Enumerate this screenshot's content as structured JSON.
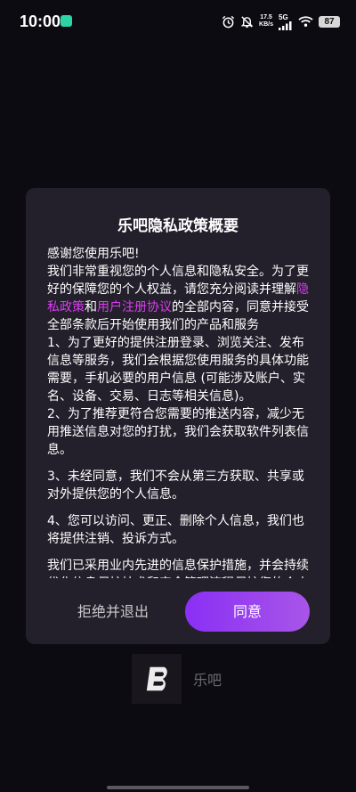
{
  "status_bar": {
    "time": "10:00",
    "net_speed_value": "17.5",
    "net_speed_unit": "KB/s",
    "network_type": "5G",
    "battery": "87",
    "icons": [
      "app-notification-icon",
      "alarm-icon",
      "mute-icon",
      "signal-icon",
      "wifi-icon",
      "battery-icon"
    ]
  },
  "dialog": {
    "title": "乐吧隐私政策概要",
    "intro_greeting": "感谢您使用乐吧!",
    "intro_p1": "我们非常重视您的个人信息和隐私安全。为了更好的保障您的个人权益，请您充分阅读并理解",
    "link_privacy": "隐私政策",
    "and": "和",
    "link_agreement": "用户注册协议",
    "intro_p2": "的全部内容，同意并接受全部条款后开始使用我们的产品和服务",
    "item1": "1、为了更好的提供注册登录、浏览关注、发布信息等服务，我们会根据您使用服务的具体功能需要，手机必要的用户信息 (可能涉及账户、实名、设备、交易、日志等相关信息)。",
    "item2": "2、为了推荐更符合您需要的推送内容，减少无用推送信息对您的打扰，我们会获取软件列表信息。",
    "item3": "3、未经同意，我们不会从第三方获取、共享或对外提供您的个人信息。",
    "item4": "4、您可以访问、更正、删除个人信息，我们也将提供注销、投诉方式。",
    "closing": "我们已采用业内先进的信息保护措施，并会持续优化信息保护技术和完全管理流程保护您的个人信息完全，感谢您的信任",
    "reject_label": "拒绝并退出",
    "agree_label": "同意",
    "agree_color": "#8a2ff5",
    "link_color": "#d93ef0"
  },
  "splash": {
    "app_name": "乐吧",
    "logo_letter": "B"
  }
}
